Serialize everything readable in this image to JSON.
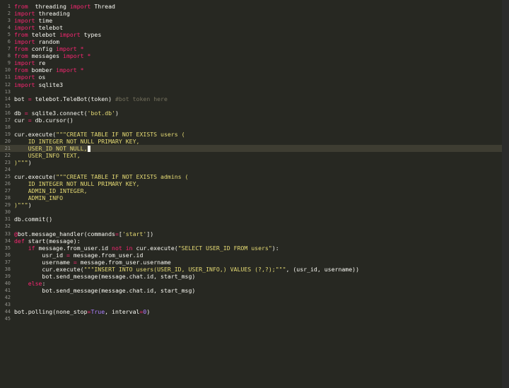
{
  "theme_colors": {
    "background": "#272822",
    "foreground": "#f8f8f2",
    "keyword": "#f92672",
    "string": "#e6db74",
    "number": "#ae81ff",
    "comment": "#75715e",
    "line_number": "#90908a",
    "active_line": "#3e3d32"
  },
  "active_line": 21,
  "lines": [
    {
      "n": "1",
      "t": [
        [
          "kw",
          "from"
        ],
        [
          "",
          "  threading "
        ],
        [
          "kw",
          "import"
        ],
        [
          "",
          " Thread"
        ]
      ]
    },
    {
      "n": "2",
      "t": [
        [
          "kw",
          "import"
        ],
        [
          "",
          " threading"
        ]
      ]
    },
    {
      "n": "3",
      "t": [
        [
          "kw",
          "import"
        ],
        [
          "",
          " time"
        ]
      ]
    },
    {
      "n": "4",
      "t": [
        [
          "kw",
          "import"
        ],
        [
          "",
          " telebot"
        ]
      ]
    },
    {
      "n": "5",
      "t": [
        [
          "kw",
          "from"
        ],
        [
          "",
          " telebot "
        ],
        [
          "kw",
          "import"
        ],
        [
          "",
          " types"
        ]
      ]
    },
    {
      "n": "6",
      "t": [
        [
          "kw",
          "import"
        ],
        [
          "",
          " random"
        ]
      ]
    },
    {
      "n": "7",
      "t": [
        [
          "kw",
          "from"
        ],
        [
          "",
          " config "
        ],
        [
          "kw",
          "import"
        ],
        [
          "",
          " "
        ],
        [
          "kw",
          "*"
        ]
      ]
    },
    {
      "n": "8",
      "t": [
        [
          "kw",
          "from"
        ],
        [
          "",
          " messages "
        ],
        [
          "kw",
          "import"
        ],
        [
          "",
          " "
        ],
        [
          "kw",
          "*"
        ]
      ]
    },
    {
      "n": "9",
      "t": [
        [
          "kw",
          "import"
        ],
        [
          "",
          " re"
        ]
      ]
    },
    {
      "n": "10",
      "t": [
        [
          "kw",
          "from"
        ],
        [
          "",
          " bomber "
        ],
        [
          "kw",
          "import"
        ],
        [
          "",
          " "
        ],
        [
          "kw",
          "*"
        ]
      ]
    },
    {
      "n": "11",
      "t": [
        [
          "kw",
          "import"
        ],
        [
          "",
          " os"
        ]
      ]
    },
    {
      "n": "12",
      "t": [
        [
          "kw",
          "import"
        ],
        [
          "",
          " sqlite3"
        ]
      ]
    },
    {
      "n": "13",
      "t": []
    },
    {
      "n": "14",
      "t": [
        [
          "",
          "bot "
        ],
        [
          "kw",
          "="
        ],
        [
          "",
          " telebot.TeleBot(token) "
        ],
        [
          "cm",
          "#bot token here"
        ]
      ]
    },
    {
      "n": "15",
      "t": []
    },
    {
      "n": "16",
      "t": [
        [
          "",
          "db "
        ],
        [
          "kw",
          "="
        ],
        [
          "",
          " sqlite3.connect("
        ],
        [
          "str",
          "'bot.db'"
        ],
        [
          "",
          ")"
        ]
      ]
    },
    {
      "n": "17",
      "t": [
        [
          "",
          "cur "
        ],
        [
          "kw",
          "="
        ],
        [
          "",
          " db.cursor()"
        ]
      ]
    },
    {
      "n": "18",
      "t": []
    },
    {
      "n": "19",
      "t": [
        [
          "",
          "cur.execute("
        ],
        [
          "str",
          "\"\"\"CREATE TABLE IF NOT EXISTS users ("
        ]
      ]
    },
    {
      "n": "20",
      "t": [
        [
          "ws",
          "    "
        ],
        [
          "str",
          "ID INTEGER NOT NULL PRIMARY KEY,"
        ]
      ]
    },
    {
      "n": "21",
      "t": [
        [
          "ws",
          "    "
        ],
        [
          "str",
          "USER_ID NOT NULL,"
        ],
        [
          "caret",
          ""
        ]
      ]
    },
    {
      "n": "22",
      "t": [
        [
          "ws",
          "    "
        ],
        [
          "str",
          "USER_INFO TEXT,"
        ]
      ]
    },
    {
      "n": "23",
      "t": [
        [
          "str",
          ")\"\"\""
        ],
        [
          "",
          ")"
        ]
      ]
    },
    {
      "n": "24",
      "t": []
    },
    {
      "n": "25",
      "t": [
        [
          "",
          "cur.execute("
        ],
        [
          "str",
          "\"\"\"CREATE TABLE IF NOT EXISTS admins ("
        ]
      ]
    },
    {
      "n": "26",
      "t": [
        [
          "ws",
          "    "
        ],
        [
          "str",
          "ID INTEGER NOT NULL PRIMARY KEY,"
        ]
      ]
    },
    {
      "n": "27",
      "t": [
        [
          "ws",
          "    "
        ],
        [
          "str",
          "ADMIN_ID INTEGER,"
        ]
      ]
    },
    {
      "n": "28",
      "t": [
        [
          "ws",
          "    "
        ],
        [
          "str",
          "ADMIN_INFO"
        ]
      ]
    },
    {
      "n": "29",
      "t": [
        [
          "str",
          ")\"\"\""
        ],
        [
          "",
          ")"
        ]
      ]
    },
    {
      "n": "30",
      "t": []
    },
    {
      "n": "31",
      "t": [
        [
          "",
          "db.commit()"
        ]
      ]
    },
    {
      "n": "32",
      "t": []
    },
    {
      "n": "33",
      "t": [
        [
          "kw",
          "@"
        ],
        [
          "",
          "bot.message_handler(commands"
        ],
        [
          "kw",
          "="
        ],
        [
          "",
          "["
        ],
        [
          "str",
          "'start'"
        ],
        [
          "",
          "])"
        ]
      ]
    },
    {
      "n": "34",
      "t": [
        [
          "kw",
          "def"
        ],
        [
          "",
          " start(message):"
        ]
      ]
    },
    {
      "n": "35",
      "t": [
        [
          "",
          "    "
        ],
        [
          "kw",
          "if"
        ],
        [
          "",
          " message.from_user.id "
        ],
        [
          "kw",
          "not in"
        ],
        [
          "",
          " cur.execute("
        ],
        [
          "str",
          "\"SELECT USER_ID FROM users\""
        ],
        [
          "",
          "):"
        ]
      ]
    },
    {
      "n": "36",
      "t": [
        [
          "",
          "        usr_id "
        ],
        [
          "kw",
          "="
        ],
        [
          "",
          " message.from_user.id"
        ]
      ]
    },
    {
      "n": "37",
      "t": [
        [
          "",
          "        username "
        ],
        [
          "kw",
          "="
        ],
        [
          "",
          " message.from_user.username"
        ]
      ]
    },
    {
      "n": "38",
      "t": [
        [
          "",
          "        cur.execute("
        ],
        [
          "str",
          "\"\"\"INSERT INTO users(USER_ID, USER_INFO,) VALUES (?,?);\"\"\""
        ],
        [
          "",
          ", (usr_id, username))"
        ]
      ]
    },
    {
      "n": "39",
      "t": [
        [
          "",
          "        bot.send_message(message.chat.id, start_msg)"
        ]
      ]
    },
    {
      "n": "40",
      "t": [
        [
          "",
          "    "
        ],
        [
          "kw",
          "else"
        ],
        [
          "",
          ":"
        ]
      ]
    },
    {
      "n": "41",
      "t": [
        [
          "",
          "        bot.send_message(message.chat.id, start_msg)"
        ]
      ]
    },
    {
      "n": "42",
      "t": []
    },
    {
      "n": "43",
      "t": []
    },
    {
      "n": "44",
      "t": [
        [
          "",
          "bot.polling(none_stop"
        ],
        [
          "kw",
          "="
        ],
        [
          "cst",
          "True"
        ],
        [
          "",
          ", interval"
        ],
        [
          "kw",
          "="
        ],
        [
          "num",
          "0"
        ],
        [
          "",
          ")"
        ]
      ]
    },
    {
      "n": "45",
      "t": []
    }
  ]
}
